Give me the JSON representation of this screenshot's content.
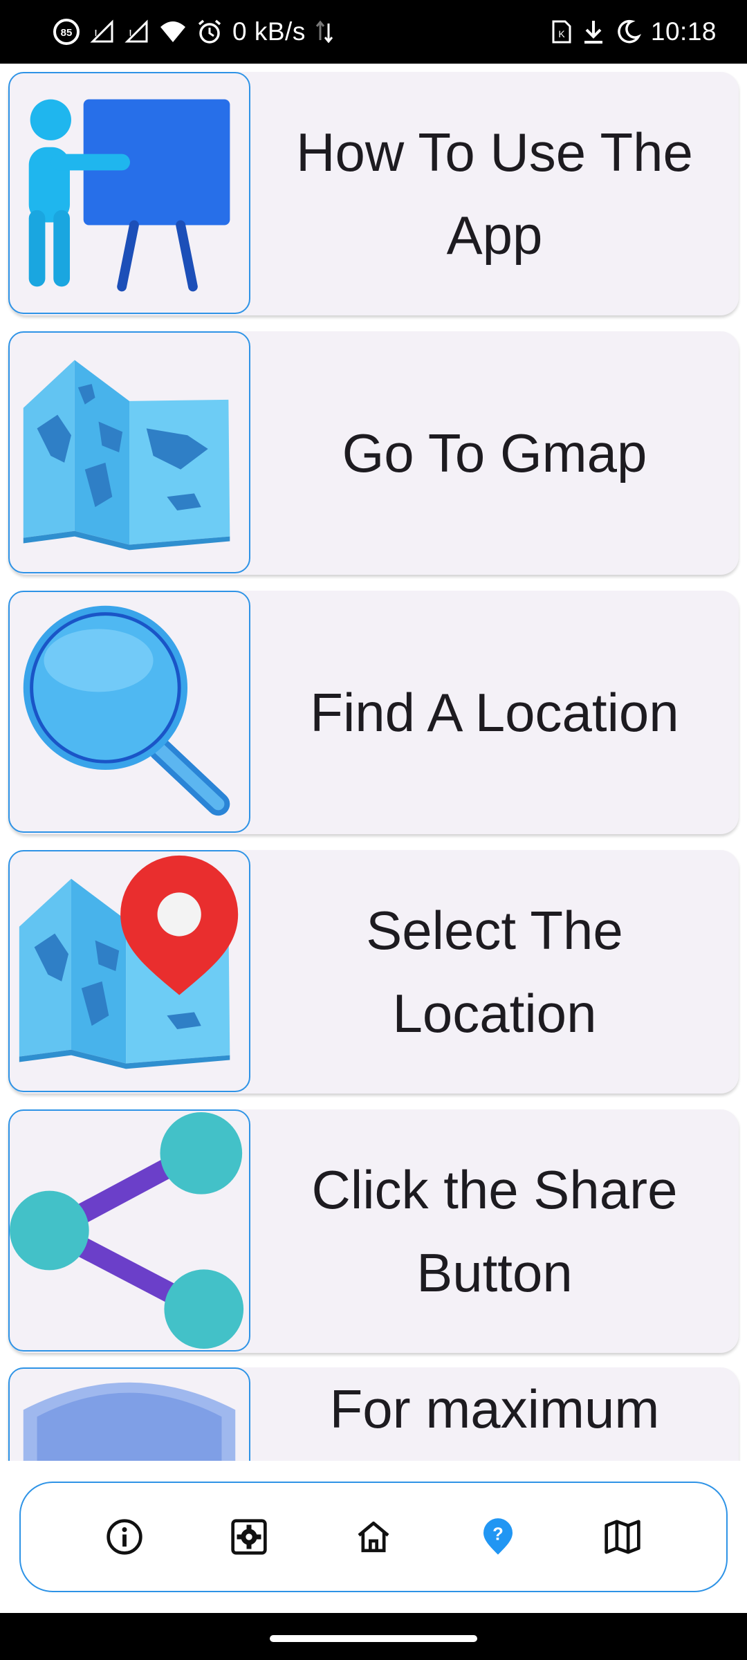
{
  "status_bar": {
    "battery_badge": "85",
    "net_speed": "0 kB/s",
    "time": "10:18"
  },
  "cards": [
    {
      "label": "How To Use The App",
      "icon": "presentation-board-icon"
    },
    {
      "label": "Go To Gmap",
      "icon": "folded-map-icon"
    },
    {
      "label": "Find A Location",
      "icon": "magnifying-glass-icon"
    },
    {
      "label": "Select The Location",
      "icon": "map-pin-icon"
    },
    {
      "label": "Click the Share Button",
      "icon": "share-icon"
    },
    {
      "label": "For maximum",
      "icon": "shield-icon"
    }
  ],
  "bottom_nav": {
    "items": [
      {
        "icon": "info-icon"
      },
      {
        "icon": "settings-icon"
      },
      {
        "icon": "home-icon"
      },
      {
        "icon": "help-icon",
        "active": true
      },
      {
        "icon": "map-icon"
      }
    ],
    "active_color": "#2196f3",
    "border_color": "#2e93e6"
  }
}
